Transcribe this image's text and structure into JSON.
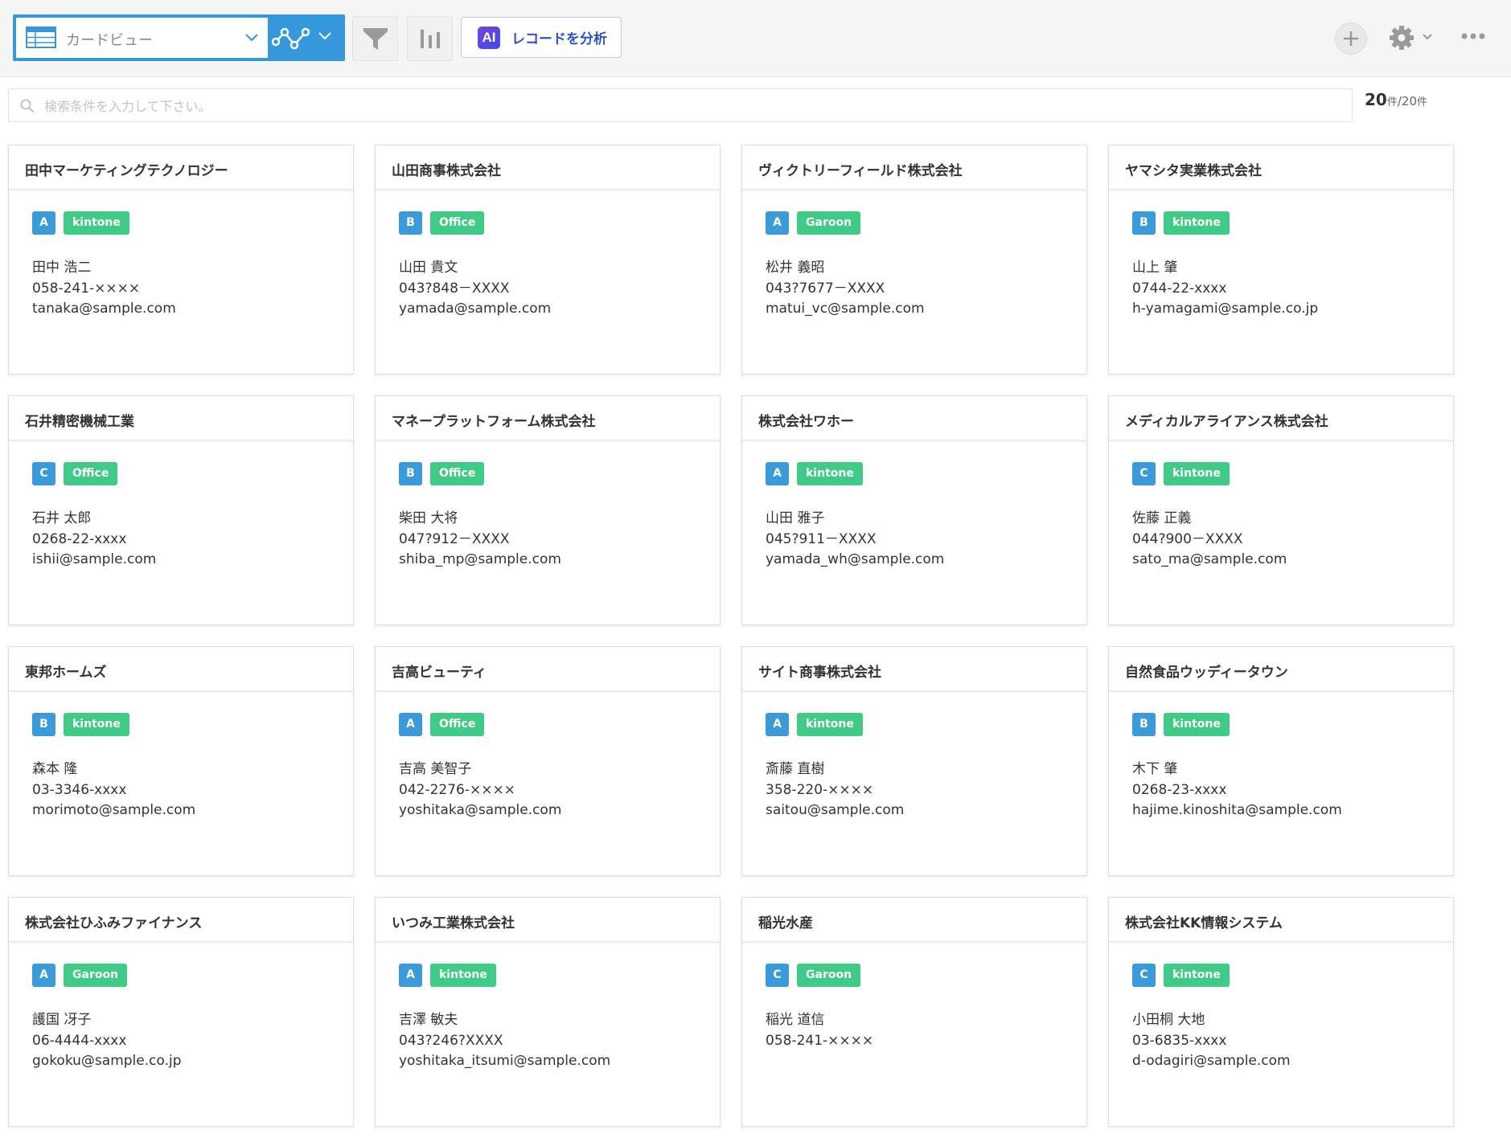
{
  "toolbar": {
    "view_label": "カードビュー",
    "ai_badge": "AI",
    "ai_button_label": "レコードを分析"
  },
  "search": {
    "placeholder": "検索条件を入力して下さい。",
    "value": ""
  },
  "count": {
    "shown": "20",
    "unit": "件",
    "separator": "/",
    "total": "20",
    "total_unit": "件"
  },
  "colors": {
    "rank_tag": "#3b9ad9",
    "product_tag": "#3fcb85",
    "view_group": "#3498db",
    "ai_text": "#2e4fd0"
  },
  "cards": [
    {
      "company": "田中マーケティングテクノロジー",
      "rank": "A",
      "product": "kintone",
      "person": "田中 浩二",
      "phone": "058-241-××××",
      "email": "tanaka@sample.com"
    },
    {
      "company": "山田商事株式会社",
      "rank": "B",
      "product": "Office",
      "person": "山田 貴文",
      "phone": "043?848－XXXX",
      "email": "yamada@sample.com"
    },
    {
      "company": "ヴィクトリーフィールド株式会社",
      "rank": "A",
      "product": "Garoon",
      "person": "松井 義昭",
      "phone": "043?7677－XXXX",
      "email": "matui_vc@sample.com"
    },
    {
      "company": "ヤマシタ実業株式会社",
      "rank": "B",
      "product": "kintone",
      "person": "山上 肇",
      "phone": "0744-22-xxxx",
      "email": "h-yamagami@sample.co.jp"
    },
    {
      "company": "石井精密機械工業",
      "rank": "C",
      "product": "Office",
      "person": "石井 太郎",
      "phone": "0268-22-xxxx",
      "email": "ishii@sample.com"
    },
    {
      "company": "マネープラットフォーム株式会社",
      "rank": "B",
      "product": "Office",
      "person": "柴田 大将",
      "phone": "047?912－XXXX",
      "email": "shiba_mp@sample.com"
    },
    {
      "company": "株式会社ワホー",
      "rank": "A",
      "product": "kintone",
      "person": "山田 雅子",
      "phone": "045?911－XXXX",
      "email": "yamada_wh@sample.com"
    },
    {
      "company": "メディカルアライアンス株式会社",
      "rank": "C",
      "product": "kintone",
      "person": "佐藤 正義",
      "phone": "044?900－XXXX",
      "email": "sato_ma@sample.com"
    },
    {
      "company": "東邦ホームズ",
      "rank": "B",
      "product": "kintone",
      "person": "森本 隆",
      "phone": "03-3346-xxxx",
      "email": "morimoto@sample.com"
    },
    {
      "company": "吉高ビューティ",
      "rank": "A",
      "product": "Office",
      "person": "吉高 美智子",
      "phone": "042-2276-××××",
      "email": "yoshitaka@sample.com"
    },
    {
      "company": "サイト商事株式会社",
      "rank": "A",
      "product": "kintone",
      "person": "斎藤 直樹",
      "phone": "358-220-××××",
      "email": "saitou@sample.com"
    },
    {
      "company": "自然食品ウッディータウン",
      "rank": "B",
      "product": "kintone",
      "person": "木下 肇",
      "phone": "0268-23-xxxx",
      "email": "hajime.kinoshita@sample.com"
    },
    {
      "company": "株式会社ひふみファイナンス",
      "rank": "A",
      "product": "Garoon",
      "person": "護国 冴子",
      "phone": "06-4444-xxxx",
      "email": "gokoku@sample.co.jp"
    },
    {
      "company": "いつみ工業株式会社",
      "rank": "A",
      "product": "kintone",
      "person": "吉澤 敏夫",
      "phone": "043?246?XXXX",
      "email": "yoshitaka_itsumi@sample.com"
    },
    {
      "company": "稲光水産",
      "rank": "C",
      "product": "Garoon",
      "person": "稲光 道信",
      "phone": "058-241-××××",
      "email": ""
    },
    {
      "company": "株式会社KK情報システム",
      "rank": "C",
      "product": "kintone",
      "person": "小田桐 大地",
      "phone": "03-6835-xxxx",
      "email": "d-odagiri@sample.com"
    }
  ]
}
